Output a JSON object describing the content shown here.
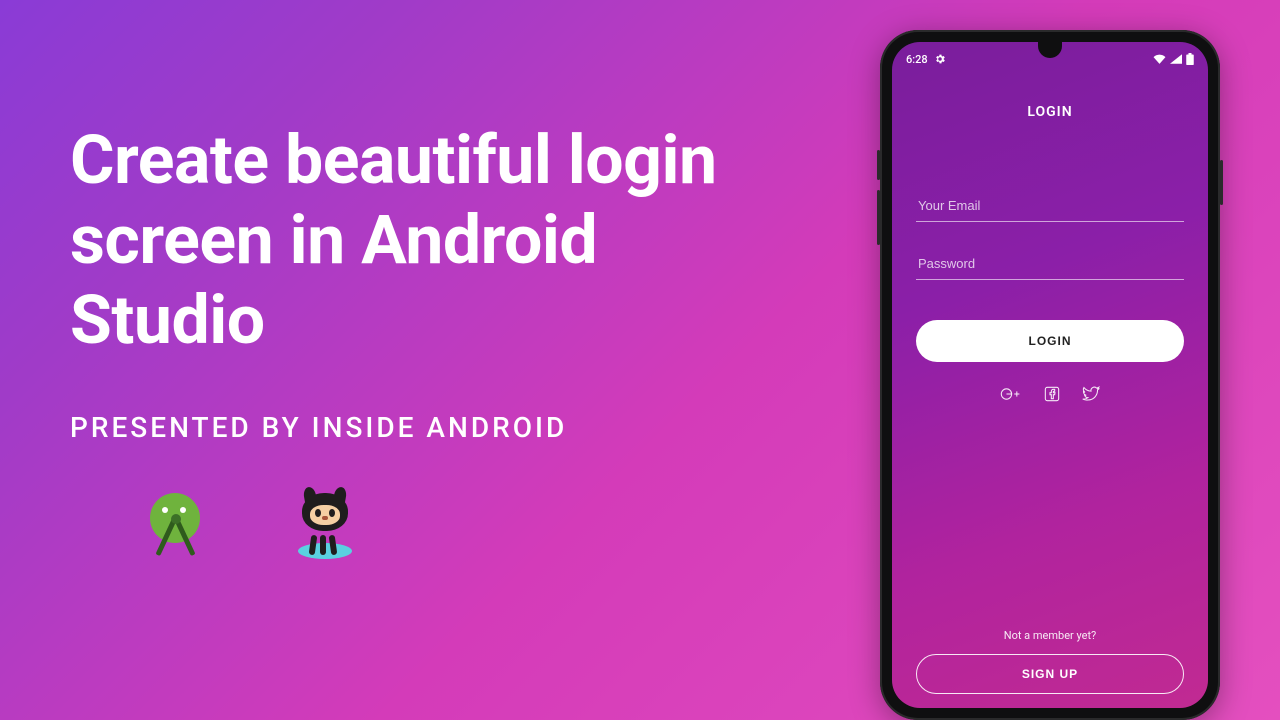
{
  "promo": {
    "title": "Create beautiful login screen in Android Studio",
    "subtitle": "PRESENTED BY INSIDE ANDROID"
  },
  "statusbar": {
    "time": "6:28"
  },
  "login": {
    "header": "LOGIN",
    "email_placeholder": "Your Email",
    "password_placeholder": "Password",
    "login_button": "LOGIN",
    "not_member": "Not a member yet?",
    "signup_button": "SIGN UP"
  }
}
